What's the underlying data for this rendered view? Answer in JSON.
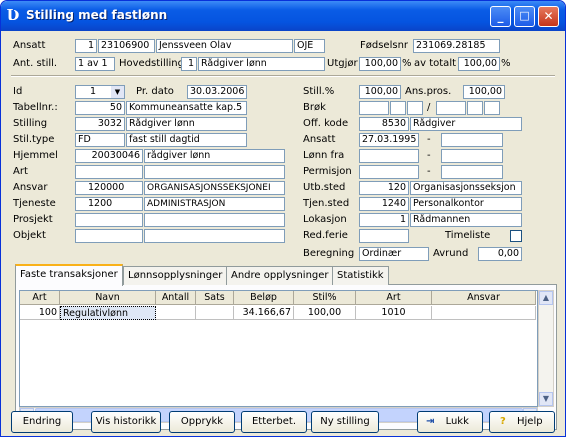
{
  "window": {
    "title": "Stilling med fastlønn",
    "minimize": "_",
    "maximize": "□",
    "close": "✕"
  },
  "header": {
    "ansatt_label": "Ansatt",
    "ansatt_nr": "1",
    "ansatt_id": "23106900",
    "ansatt_navn": "Jenssveen Olav",
    "ansatt_kode": "OJE",
    "fodselsnr_label": "Fødselsnr",
    "fodselsnr": "231069.28185",
    "antstill_label": "Ant. still.",
    "antstill": "1 av 1",
    "hovedstilling_label": "Hovedstilling",
    "hovedstilling_nr": "1",
    "hovedstilling": "Rådgiver lønn",
    "utgjor_label": "Utgjør",
    "utgjor": "100,00",
    "pct1": "%",
    "avtotalt_label": "av totalt",
    "avtotalt": "100,00",
    "pct2": "%"
  },
  "left": {
    "id_label": "Id",
    "id": "1",
    "prdato_label": "Pr. dato",
    "prdato": "30.03.2006",
    "tabellnr_label": "Tabellnr.:",
    "tabellnr": "50",
    "tabellnr_text": "Kommuneansatte kap.5",
    "stilling_label": "Stilling",
    "stilling_nr": "3032",
    "stilling_text": "Rådgiver lønn",
    "stiltype_label": "Stil.type",
    "stiltype": "FD",
    "stiltype_text": "fast still dagtid",
    "hjemmel_label": "Hjemmel",
    "hjemmel": "20030046",
    "hjemmel_text": "rådgiver lønn",
    "art_label": "Art",
    "ansvar_label": "Ansvar",
    "ansvar": "120000",
    "ansvar_text": "ORGANISASJONSSEKSJONEI",
    "tjeneste_label": "Tjeneste",
    "tjeneste": "1200",
    "tjeneste_text": "ADMINISTRASJON",
    "prosjekt_label": "Prosjekt",
    "objekt_label": "Objekt"
  },
  "right": {
    "still_label": "Still.%",
    "still": "100,00",
    "anspros_label": "Ans.pros.",
    "anspros": "100,00",
    "brok_label": "Brøk",
    "slash": "/",
    "offkode_label": "Off. kode",
    "offkode": "8530",
    "offkode_text": "Rådgiver",
    "ansatt_label": "Ansatt",
    "ansatt": "27.03.1995",
    "dash": "-",
    "lonnfra_label": "Lønn fra",
    "permisjon_label": "Permisjon",
    "utbsted_label": "Utb.sted",
    "utbsted": "120",
    "utbsted_text": "Organisasjonsseksjon",
    "tjensted_label": "Tjen.sted",
    "tjensted": "1240",
    "tjensted_text": "Personalkontor",
    "lokasjon_label": "Lokasjon",
    "lokasjon": "1",
    "lokasjon_text": "Rådmannen",
    "redferie_label": "Red.ferie",
    "timeliste_label": "Timeliste",
    "beregning_label": "Beregning",
    "beregning": "Ordinær",
    "avrund_label": "Avrund",
    "avrund": "0,00"
  },
  "tabs": [
    "Faste transaksjoner",
    "Lønnsopplysninger",
    "Andre opplysninger",
    "Statistikk"
  ],
  "table": {
    "columns": [
      "Art",
      "Navn",
      "Antall",
      "Sats",
      "Beløp",
      "Stil%",
      "Art",
      "Ansvar"
    ],
    "rows": [
      [
        "100",
        "Regulativlønn",
        "",
        "",
        "34.166,67",
        "100,00",
        "1010",
        ""
      ]
    ]
  },
  "buttons": {
    "endring": "Endring",
    "historikk": "Vis historikk",
    "opprykk": "Opprykk",
    "etterbet": "Etterbet.",
    "nystilling": "Ny stilling",
    "lukk": "Lukk",
    "hjelp": "Hjelp"
  },
  "colors": {
    "titlebar": "#0554e0",
    "tab_highlight": "#f9b119"
  }
}
